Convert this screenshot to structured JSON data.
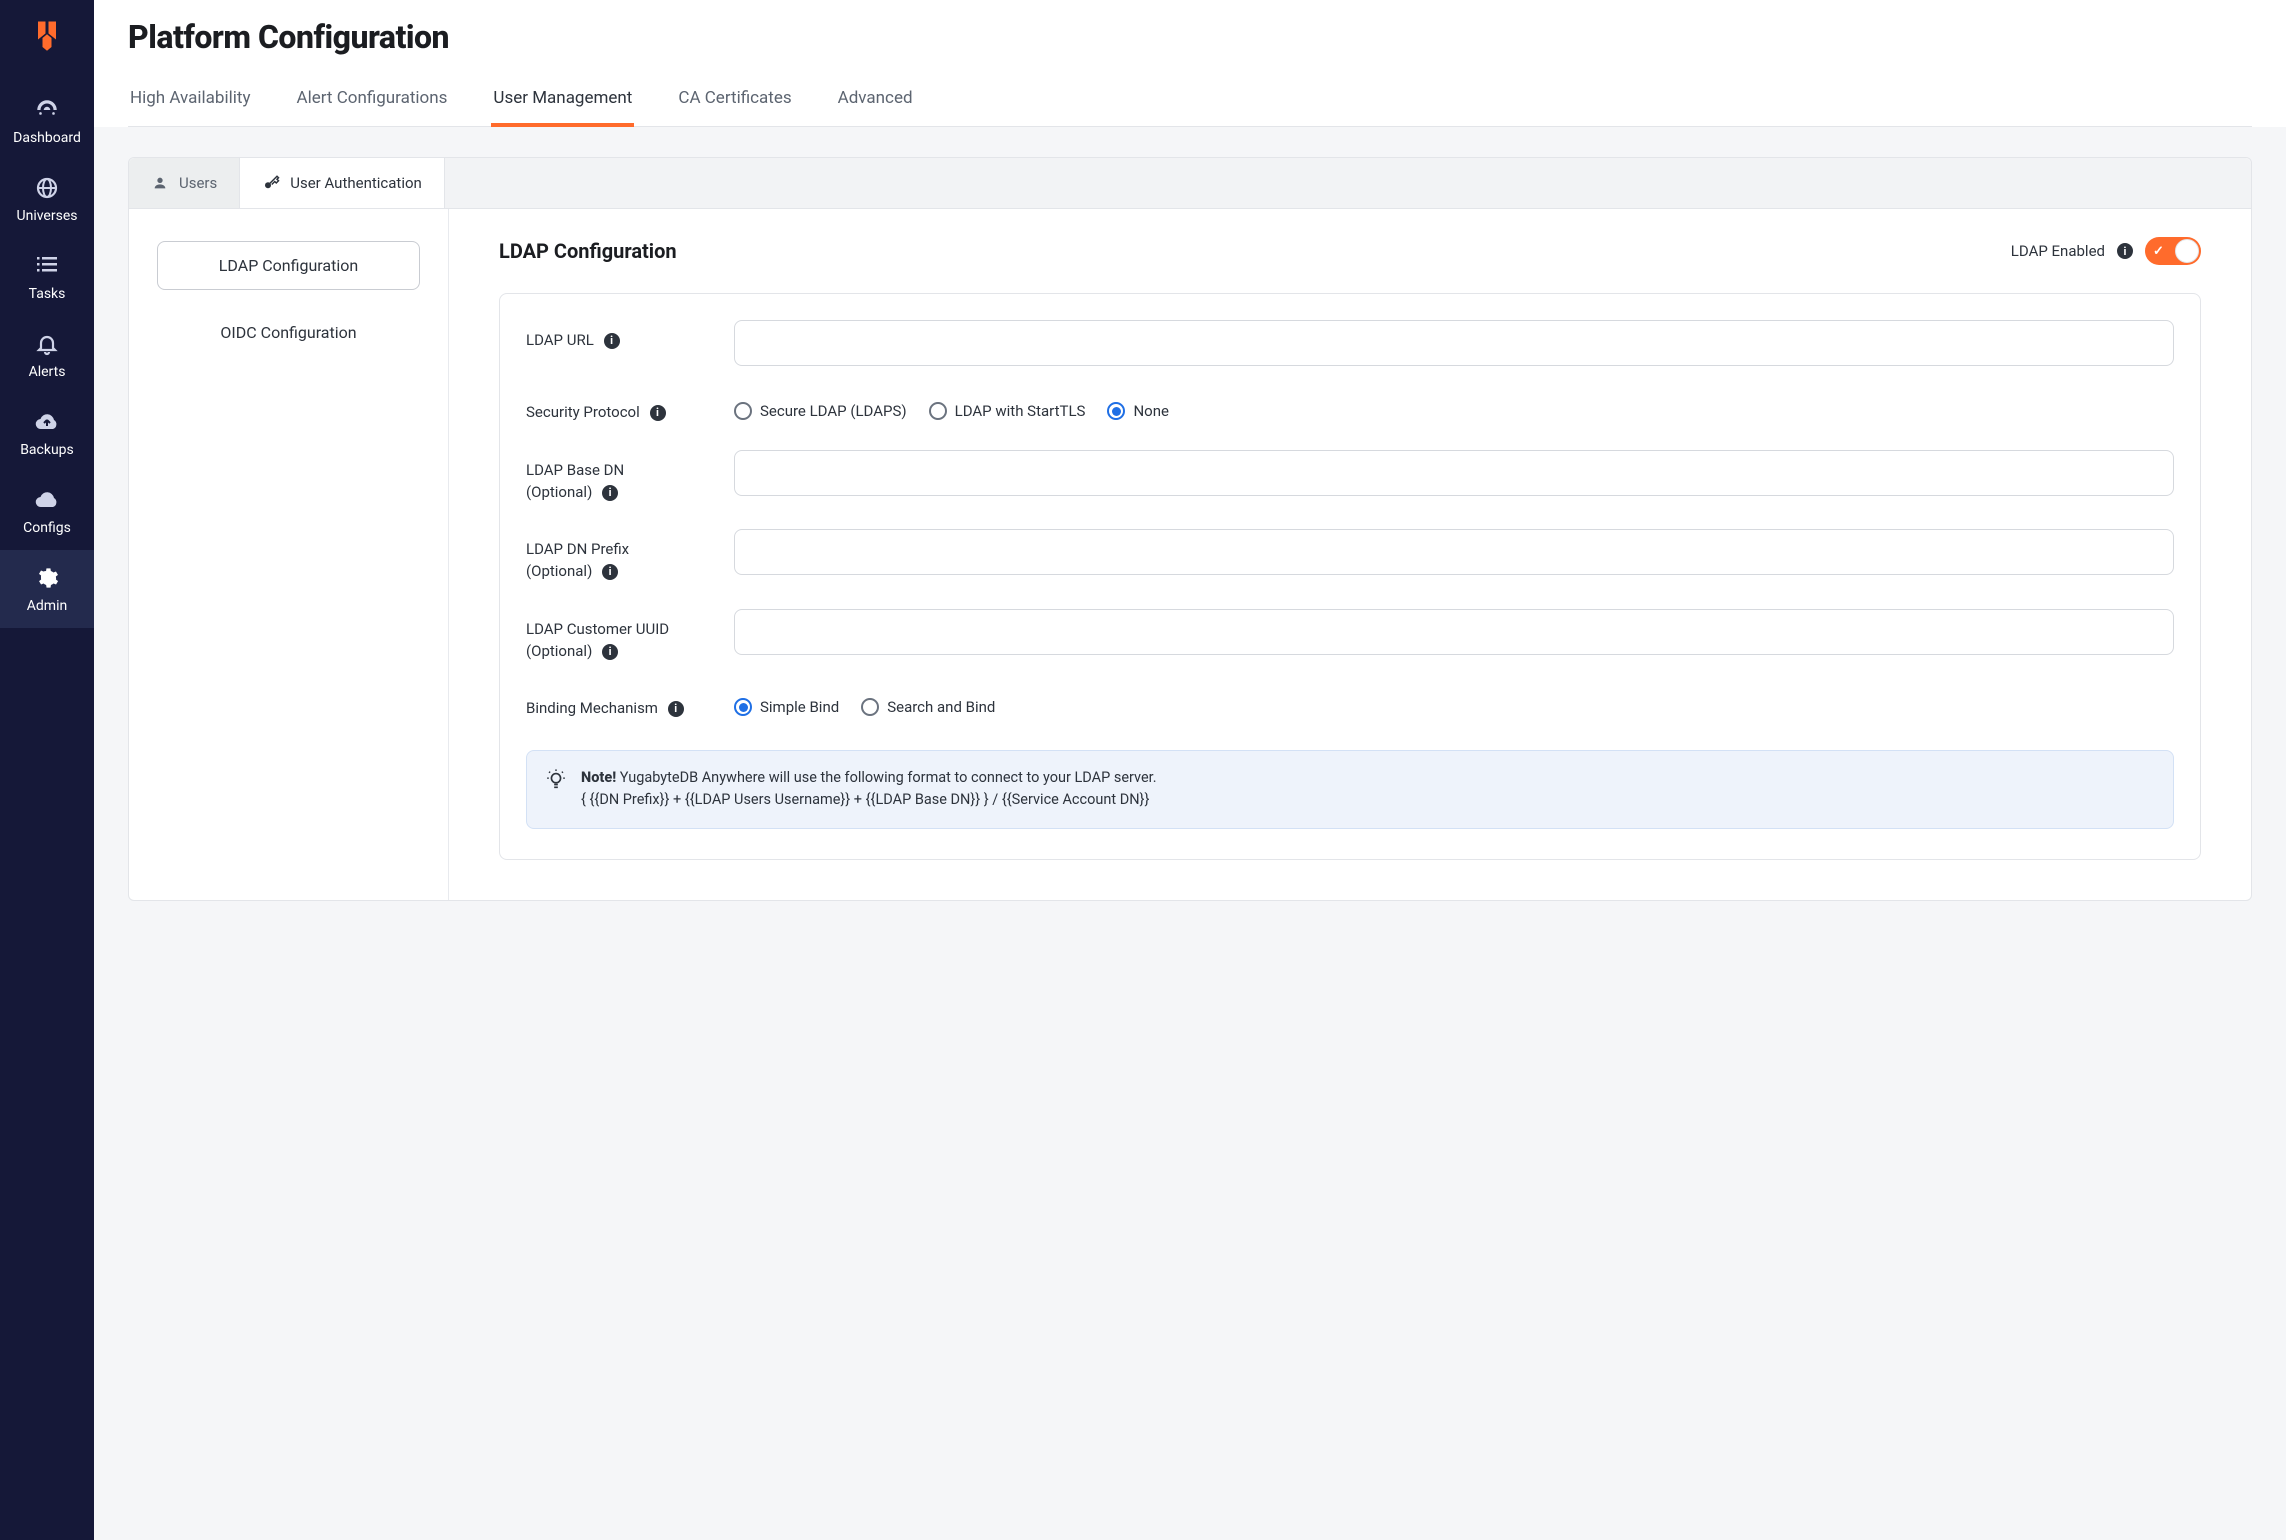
{
  "sidebar": {
    "items": [
      {
        "label": "Dashboard"
      },
      {
        "label": "Universes"
      },
      {
        "label": "Tasks"
      },
      {
        "label": "Alerts"
      },
      {
        "label": "Backups"
      },
      {
        "label": "Configs"
      },
      {
        "label": "Admin"
      }
    ]
  },
  "page": {
    "title": "Platform Configuration"
  },
  "topTabs": [
    {
      "label": "High Availability"
    },
    {
      "label": "Alert Configurations"
    },
    {
      "label": "User Management"
    },
    {
      "label": "CA Certificates"
    },
    {
      "label": "Advanced"
    }
  ],
  "subTabs": {
    "users": "Users",
    "auth": "User Authentication"
  },
  "leftNav": {
    "ldap": "LDAP Configuration",
    "oidc": "OIDC Configuration"
  },
  "section": {
    "title": "LDAP Configuration",
    "toggleLabel": "LDAP Enabled"
  },
  "form": {
    "ldapUrlLabel": "LDAP URL",
    "ldapUrlValue": "",
    "secProtoLabel": "Security Protocol",
    "secProtoOptions": {
      "ldaps": "Secure LDAP (LDAPS)",
      "starttls": "LDAP with StartTLS",
      "none": "None"
    },
    "baseDnLabel1": "LDAP Base DN",
    "baseDnLabel2": "(Optional)",
    "baseDnValue": "",
    "dnPrefixLabel1": "LDAP DN Prefix",
    "dnPrefixLabel2": "(Optional)",
    "dnPrefixValue": "",
    "custUuidLabel1": "LDAP Customer UUID",
    "custUuidLabel2": "(Optional)",
    "custUuidValue": "",
    "bindLabel": "Binding Mechanism",
    "bindOptions": {
      "simple": "Simple Bind",
      "search": "Search and Bind"
    }
  },
  "note": {
    "bold": "Note!",
    "line1": " YugabyteDB Anywhere will use the following format to connect to your LDAP server.",
    "line2": "{ {{DN Prefix}} + {{LDAP Users Username}} + {{LDAP Base DN}} } / {{Service Account DN}}"
  }
}
